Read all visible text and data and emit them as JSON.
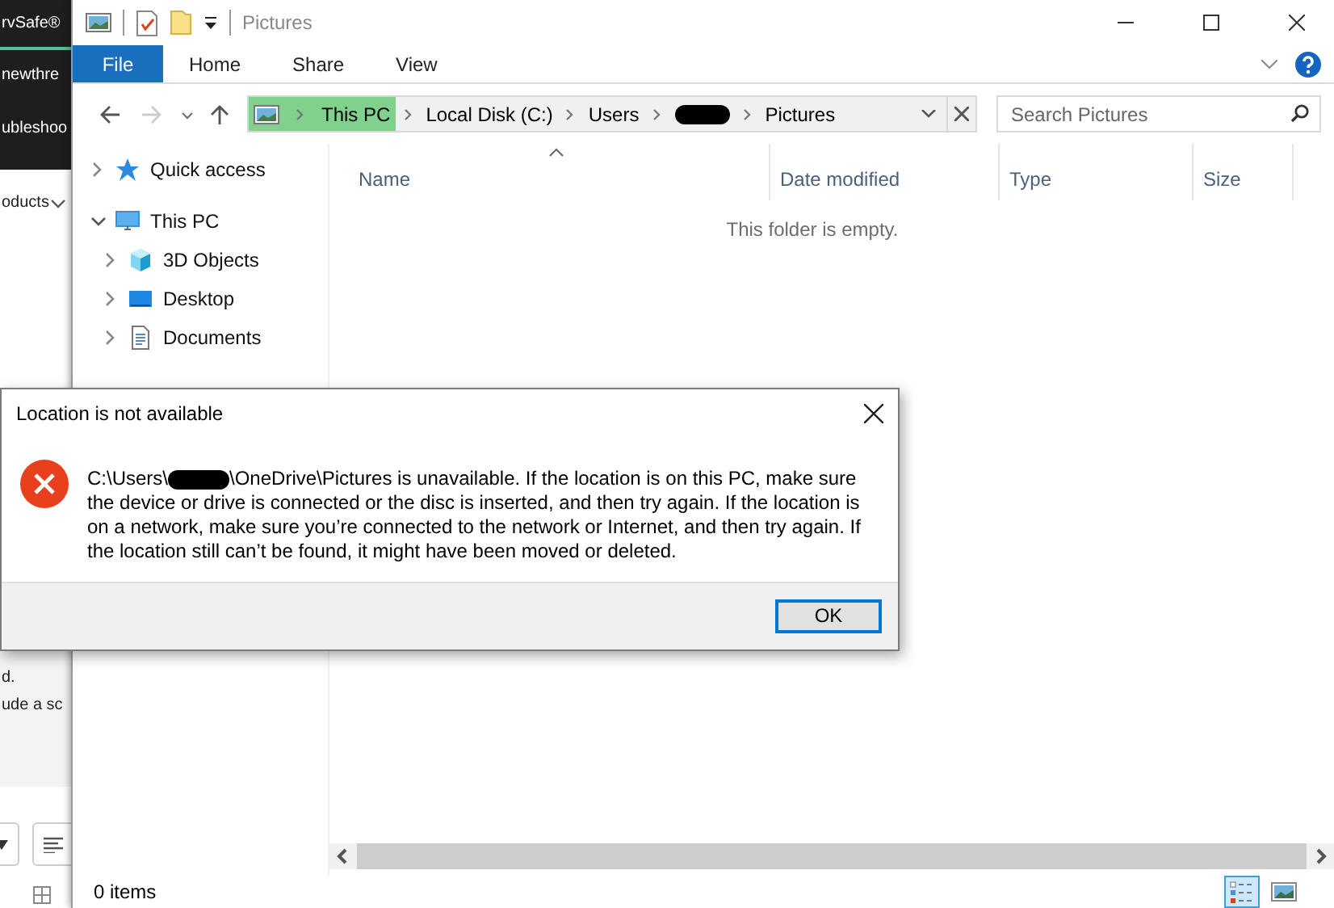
{
  "background_app": {
    "header_lines": [
      "rvSafe®",
      "newthre",
      "ubleshoo"
    ],
    "menu_item": "oducts",
    "body_lines": [
      "d.",
      "ude a sc"
    ]
  },
  "window": {
    "title": "Pictures"
  },
  "ribbon_tabs": [
    {
      "label": "File",
      "kind": "file"
    },
    {
      "label": "Home",
      "kind": "tab"
    },
    {
      "label": "Share",
      "kind": "tab"
    },
    {
      "label": "View",
      "kind": "tab"
    }
  ],
  "address_bar": {
    "crumbs": [
      {
        "kind": "label",
        "label": "This PC",
        "highlighted": true
      },
      {
        "kind": "label",
        "label": "Local Disk (C:)",
        "highlighted": false
      },
      {
        "kind": "label",
        "label": "Users",
        "highlighted": false
      },
      {
        "kind": "redacted",
        "highlighted": false
      },
      {
        "kind": "label",
        "label": "Pictures",
        "highlighted": false
      }
    ]
  },
  "search": {
    "placeholder": "Search Pictures"
  },
  "nav_tree": [
    {
      "label": "Quick access",
      "kind": "star",
      "expanded": false
    },
    {
      "label": "This PC",
      "kind": "pc",
      "expanded": true,
      "children": [
        {
          "label": "3D Objects",
          "kind": "cube",
          "expanded": false
        },
        {
          "label": "Desktop",
          "kind": "desktop",
          "expanded": false
        },
        {
          "label": "Documents",
          "kind": "document",
          "expanded": false
        }
      ]
    }
  ],
  "columns": [
    {
      "label": "Name",
      "sorted": true
    },
    {
      "label": "Date modified",
      "sorted": false
    },
    {
      "label": "Type",
      "sorted": false
    },
    {
      "label": "Size",
      "sorted": false
    }
  ],
  "empty_message": "This folder is empty.",
  "status_bar": {
    "item_count": "0 items",
    "views": [
      {
        "kind": "details",
        "selected": true
      },
      {
        "kind": "large_icons",
        "selected": false
      }
    ]
  },
  "dialog": {
    "title": "Location is not available",
    "message_before": "C:\\Users\\",
    "message_after": "\\OneDrive\\Pictures is unavailable. If the location is on this PC, make sure the device or drive is connected or the disc is inserted, and then try again. If the location is on a network, make sure you’re connected to the network or Internet, and then try again. If the location still can’t be found, it might have been moved or deleted.",
    "button": "OK"
  }
}
